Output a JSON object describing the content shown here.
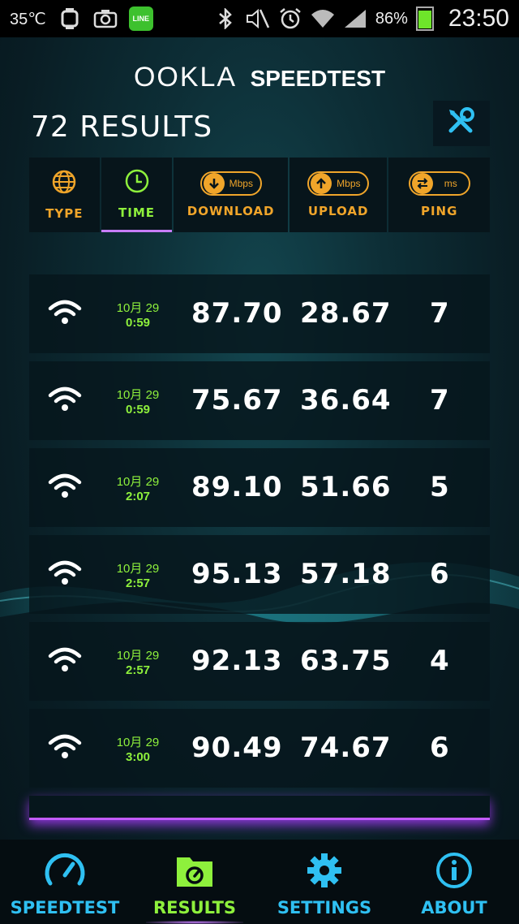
{
  "status_bar": {
    "temperature": "35℃",
    "battery_percent": "86%",
    "battery_level": 0.86,
    "time": "23:50",
    "icons": [
      "watch-icon",
      "camera-icon",
      "line-icon",
      "bluetooth-icon",
      "mute-icon",
      "alarm-icon",
      "wifi-icon",
      "signal-icon",
      "battery-icon"
    ],
    "line_label": "LINE"
  },
  "header": {
    "brand_ookla": "OOKLA",
    "brand_speedtest": "SPEEDTEST",
    "results_count": "72 RESULTS",
    "tools_icon": "tools-icon"
  },
  "columns": [
    {
      "label": "TYPE",
      "icon": "globe-icon"
    },
    {
      "label": "TIME",
      "icon": "clock-icon",
      "active": true
    },
    {
      "label": "DOWNLOAD",
      "icon": "download-icon",
      "unit": "Mbps"
    },
    {
      "label": "UPLOAD",
      "icon": "upload-icon",
      "unit": "Mbps"
    },
    {
      "label": "PING",
      "icon": "ping-icon",
      "unit": "ms"
    }
  ],
  "results": [
    {
      "type": "wifi",
      "date": "10月 29",
      "time": "0:59",
      "download": "87.70",
      "upload": "28.67",
      "ping": "7"
    },
    {
      "type": "wifi",
      "date": "10月 29",
      "time": "0:59",
      "download": "75.67",
      "upload": "36.64",
      "ping": "7"
    },
    {
      "type": "wifi",
      "date": "10月 29",
      "time": "2:07",
      "download": "89.10",
      "upload": "51.66",
      "ping": "5"
    },
    {
      "type": "wifi",
      "date": "10月 29",
      "time": "2:57",
      "download": "95.13",
      "upload": "57.18",
      "ping": "6"
    },
    {
      "type": "wifi",
      "date": "10月 29",
      "time": "2:57",
      "download": "92.13",
      "upload": "63.75",
      "ping": "4"
    },
    {
      "type": "wifi",
      "date": "10月 29",
      "time": "3:00",
      "download": "90.49",
      "upload": "74.67",
      "ping": "6"
    }
  ],
  "bottom_nav": [
    {
      "label": "SPEEDTEST",
      "icon": "speedometer-icon"
    },
    {
      "label": "RESULTS",
      "icon": "folder-icon",
      "active": true
    },
    {
      "label": "SETTINGS",
      "icon": "gear-icon"
    },
    {
      "label": "ABOUT",
      "icon": "info-icon"
    }
  ],
  "colors": {
    "accent_orange": "#f0a52a",
    "accent_green": "#8ef03c",
    "accent_blue": "#2fc0f2",
    "accent_purple": "#c77dff"
  }
}
